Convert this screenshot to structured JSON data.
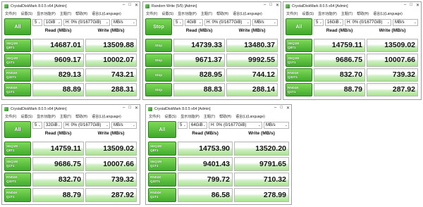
{
  "menu": [
    "文件(F)",
    "设置(S)",
    "显示功能(P)",
    "主题(T)",
    "帮助(H)",
    "语言(L)(Language)"
  ],
  "header": {
    "read": "Read (MB/s)",
    "write": "Write (MB/s)"
  },
  "units": "MB/s",
  "drive": "H: 0% (0/1677GiB)",
  "windows": [
    {
      "title": "CrystalDiskMark 8.0.5 x64 [Admin]",
      "button": "All",
      "count": "5",
      "size": "1GiB",
      "rows": [
        {
          "l1": "SEQ1M",
          "l2": "Q8T1",
          "read": "14687.01",
          "write": "13509.88"
        },
        {
          "l1": "SEQ1M",
          "l2": "Q1T1",
          "read": "9609.17",
          "write": "10002.07"
        },
        {
          "l1": "RND4K",
          "l2": "Q32T1",
          "read": "829.13",
          "write": "743.21"
        },
        {
          "l1": "RND4K",
          "l2": "Q1T1",
          "read": "88.89",
          "write": "288.31"
        }
      ]
    },
    {
      "title": "Random Write (5/5) [Admin]",
      "button": "Stop",
      "count": "5",
      "size": "4GiB",
      "rows": [
        {
          "l1": "Stop",
          "l2": "",
          "read": "14739.33",
          "write": "13480.37"
        },
        {
          "l1": "Stop",
          "l2": "",
          "read": "9671.37",
          "write": "9992.55"
        },
        {
          "l1": "Stop",
          "l2": "",
          "read": "828.95",
          "write": "744.12"
        },
        {
          "l1": "Stop",
          "l2": "",
          "read": "88.83",
          "write": "288.14"
        }
      ]
    },
    {
      "title": "CrystalDiskMark 8.0.5 x64 [Admin]",
      "button": "All",
      "count": "5",
      "size": "16GiB",
      "rows": [
        {
          "l1": "SEQ1M",
          "l2": "Q8T1",
          "read": "14759.11",
          "write": "13509.02"
        },
        {
          "l1": "SEQ1M",
          "l2": "Q1T1",
          "read": "9686.75",
          "write": "10007.66"
        },
        {
          "l1": "RND4K",
          "l2": "Q32T1",
          "read": "832.70",
          "write": "739.32"
        },
        {
          "l1": "RND4K",
          "l2": "Q1T1",
          "read": "88.79",
          "write": "287.92"
        }
      ]
    },
    {
      "title": "CrystalDiskMark 8.0.5 x64 [Admin]",
      "button": "All",
      "count": "5",
      "size": "32GiB",
      "rows": [
        {
          "l1": "SEQ1M",
          "l2": "Q8T1",
          "read": "14759.11",
          "write": "13509.02"
        },
        {
          "l1": "SEQ1M",
          "l2": "Q1T1",
          "read": "9686.75",
          "write": "10007.66"
        },
        {
          "l1": "RND4K",
          "l2": "Q32T1",
          "read": "832.70",
          "write": "739.32"
        },
        {
          "l1": "RND4K",
          "l2": "Q1T1",
          "read": "88.79",
          "write": "287.92"
        }
      ]
    },
    {
      "title": "CrystalDiskMark 8.0.5 x64 [Admin]",
      "button": "All",
      "count": "5",
      "size": "64GiB",
      "rows": [
        {
          "l1": "SEQ1M",
          "l2": "Q8T1",
          "read": "14753.90",
          "write": "13520.20"
        },
        {
          "l1": "SEQ1M",
          "l2": "Q1T1",
          "read": "9401.43",
          "write": "9791.65"
        },
        {
          "l1": "RND4K",
          "l2": "Q32T1",
          "read": "799.72",
          "write": "710.32"
        },
        {
          "l1": "RND4K",
          "l2": "Q1T1",
          "read": "86.58",
          "write": "278.99"
        }
      ]
    }
  ]
}
